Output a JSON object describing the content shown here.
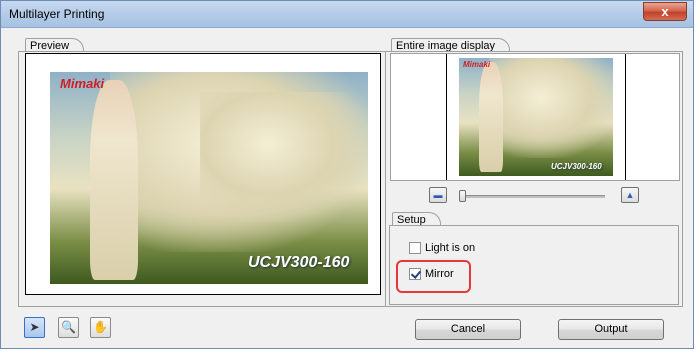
{
  "window": {
    "title": "Multilayer Printing",
    "close_label": "x"
  },
  "preview": {
    "tab_label": "Preview",
    "logo": "Mimaki",
    "model": "UCJV300-160"
  },
  "entire_image": {
    "tab_label": "Entire image display",
    "logo": "Mimaki",
    "model": "UCJV300-160",
    "zoom_level": 0.0
  },
  "setup": {
    "tab_label": "Setup",
    "options": [
      {
        "label": "Light is on",
        "checked": false
      },
      {
        "label": "Mirror",
        "checked": true
      }
    ]
  },
  "tools": [
    {
      "name": "pointer",
      "glyph": "➤",
      "active": true
    },
    {
      "name": "zoom",
      "glyph": "🔍",
      "active": false
    },
    {
      "name": "hand",
      "glyph": "✋",
      "active": false
    }
  ],
  "buttons": {
    "cancel": "Cancel",
    "output": "Output"
  },
  "colors": {
    "title_bar": "#b6cde9",
    "highlight": "#e53939",
    "logo_red": "#d21f26"
  }
}
